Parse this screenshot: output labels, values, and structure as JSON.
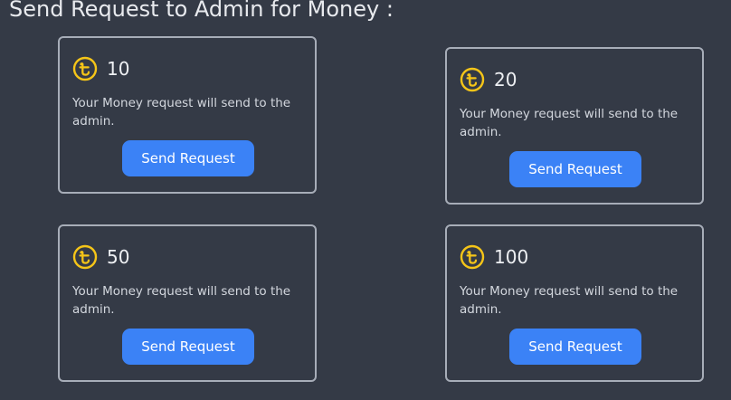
{
  "page": {
    "title": "Send Request to Admin for Money :"
  },
  "colors": {
    "background": "#343a46",
    "card_border": "#a7adb8",
    "button": "#3b82f6",
    "coin": "#f5c518"
  },
  "cards": [
    {
      "icon": "taka-coin-icon",
      "amount": "10",
      "description": "Your Money request will send to the admin.",
      "button_label": "Send Request"
    },
    {
      "icon": "taka-coin-icon",
      "amount": "20",
      "description": "Your Money request will send to the admin.",
      "button_label": "Send Request"
    },
    {
      "icon": "taka-coin-icon",
      "amount": "50",
      "description": "Your Money request will send to the admin.",
      "button_label": "Send Request"
    },
    {
      "icon": "taka-coin-icon",
      "amount": "100",
      "description": "Your Money request will send to the admin.",
      "button_label": "Send Request"
    }
  ]
}
